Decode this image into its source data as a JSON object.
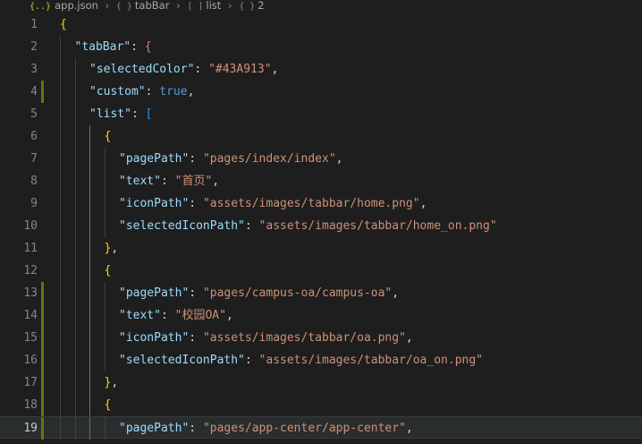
{
  "breadcrumb": {
    "file_icon": "{..}",
    "file": "app.json",
    "items": [
      {
        "icon": "{ }",
        "label": "tabBar"
      },
      {
        "icon": "[ ]",
        "label": "list"
      },
      {
        "icon": "{ }",
        "label": "2"
      }
    ]
  },
  "editor": {
    "current_line": 19,
    "modified_lines": [
      4,
      13,
      14,
      15,
      16,
      17,
      18,
      19
    ],
    "lines": [
      {
        "n": "1",
        "tokens": [
          {
            "t": "{",
            "c": "b1"
          }
        ]
      },
      {
        "n": "2",
        "tokens": [
          {
            "t": "\"tabBar\"",
            "c": "key"
          },
          {
            "t": ": ",
            "c": "p"
          },
          {
            "t": "{",
            "c": "b2"
          }
        ]
      },
      {
        "n": "3",
        "tokens": [
          {
            "t": "\"selectedColor\"",
            "c": "key"
          },
          {
            "t": ": ",
            "c": "p"
          },
          {
            "t": "\"#43A913\"",
            "c": "str"
          },
          {
            "t": ",",
            "c": "p"
          }
        ]
      },
      {
        "n": "4",
        "tokens": [
          {
            "t": "\"custom\"",
            "c": "key"
          },
          {
            "t": ": ",
            "c": "p"
          },
          {
            "t": "true",
            "c": "kw"
          },
          {
            "t": ",",
            "c": "p"
          }
        ]
      },
      {
        "n": "5",
        "tokens": [
          {
            "t": "\"list\"",
            "c": "key"
          },
          {
            "t": ": ",
            "c": "p"
          },
          {
            "t": "[",
            "c": "b3"
          }
        ]
      },
      {
        "n": "6",
        "tokens": [
          {
            "t": "{",
            "c": "b1"
          }
        ]
      },
      {
        "n": "7",
        "tokens": [
          {
            "t": "\"pagePath\"",
            "c": "key"
          },
          {
            "t": ": ",
            "c": "p"
          },
          {
            "t": "\"pages/index/index\"",
            "c": "str"
          },
          {
            "t": ",",
            "c": "p"
          }
        ]
      },
      {
        "n": "8",
        "tokens": [
          {
            "t": "\"text\"",
            "c": "key"
          },
          {
            "t": ": ",
            "c": "p"
          },
          {
            "t": "\"首页\"",
            "c": "str"
          },
          {
            "t": ",",
            "c": "p"
          }
        ]
      },
      {
        "n": "9",
        "tokens": [
          {
            "t": "\"iconPath\"",
            "c": "key"
          },
          {
            "t": ": ",
            "c": "p"
          },
          {
            "t": "\"assets/images/tabbar/home.png\"",
            "c": "str"
          },
          {
            "t": ",",
            "c": "p"
          }
        ]
      },
      {
        "n": "10",
        "tokens": [
          {
            "t": "\"selectedIconPath\"",
            "c": "key"
          },
          {
            "t": ": ",
            "c": "p"
          },
          {
            "t": "\"assets/images/tabbar/home_on.png\"",
            "c": "str"
          }
        ]
      },
      {
        "n": "11",
        "tokens": [
          {
            "t": "}",
            "c": "b1"
          },
          {
            "t": ",",
            "c": "p"
          }
        ]
      },
      {
        "n": "12",
        "tokens": [
          {
            "t": "{",
            "c": "b1"
          }
        ]
      },
      {
        "n": "13",
        "tokens": [
          {
            "t": "\"pagePath\"",
            "c": "key"
          },
          {
            "t": ": ",
            "c": "p"
          },
          {
            "t": "\"pages/campus-oa/campus-oa\"",
            "c": "str"
          },
          {
            "t": ",",
            "c": "p"
          }
        ]
      },
      {
        "n": "14",
        "tokens": [
          {
            "t": "\"text\"",
            "c": "key"
          },
          {
            "t": ": ",
            "c": "p"
          },
          {
            "t": "\"校园OA\"",
            "c": "str"
          },
          {
            "t": ",",
            "c": "p"
          }
        ]
      },
      {
        "n": "15",
        "tokens": [
          {
            "t": "\"iconPath\"",
            "c": "key"
          },
          {
            "t": ": ",
            "c": "p"
          },
          {
            "t": "\"assets/images/tabbar/oa.png\"",
            "c": "str"
          },
          {
            "t": ",",
            "c": "p"
          }
        ]
      },
      {
        "n": "16",
        "tokens": [
          {
            "t": "\"selectedIconPath\"",
            "c": "key"
          },
          {
            "t": ": ",
            "c": "p"
          },
          {
            "t": "\"assets/images/tabbar/oa_on.png\"",
            "c": "str"
          }
        ]
      },
      {
        "n": "17",
        "tokens": [
          {
            "t": "}",
            "c": "b1"
          },
          {
            "t": ",",
            "c": "p"
          }
        ]
      },
      {
        "n": "18",
        "tokens": [
          {
            "t": "{",
            "c": "b1"
          }
        ]
      },
      {
        "n": "19",
        "tokens": [
          {
            "t": "\"pagePath\"",
            "c": "key"
          },
          {
            "t": ": ",
            "c": "p"
          },
          {
            "t": "\"pages/app-center/app-center\"",
            "c": "str"
          },
          {
            "t": ",",
            "c": "p"
          }
        ]
      }
    ]
  }
}
